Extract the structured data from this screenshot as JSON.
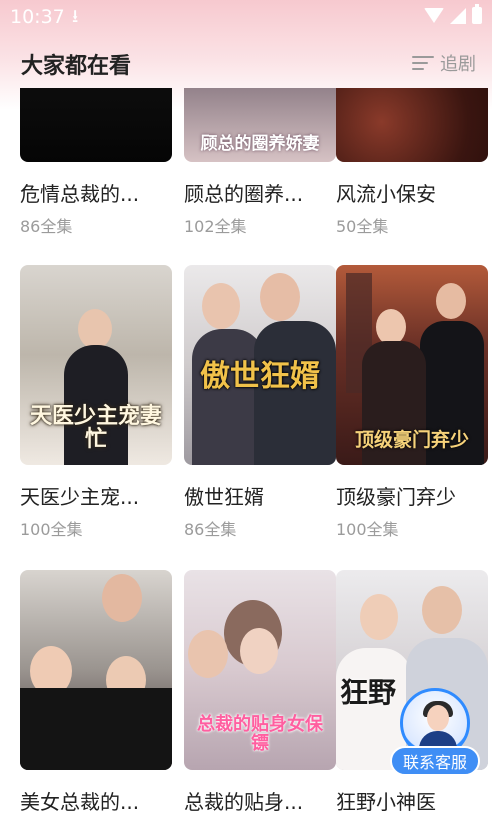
{
  "status_bar": {
    "time": "10:37",
    "download_icon": "download-icon",
    "wifi_icon": "wifi-icon",
    "signal_icon": "signal-icon",
    "battery_icon": "battery-icon"
  },
  "header": {
    "title": "大家都在看",
    "follow_label": "追剧",
    "follow_icon": "list-icon"
  },
  "dramas": [
    {
      "title": "危情总裁的...",
      "episodes": "86全集",
      "poster_text": ""
    },
    {
      "title": "顾总的圈养...",
      "episodes": "102全集",
      "poster_text": "顾总的圈养娇妻"
    },
    {
      "title": "风流小保安",
      "episodes": "50全集",
      "poster_text": ""
    },
    {
      "title": "天医少主宠...",
      "episodes": "100全集",
      "poster_text": "天医少主宠妻忙"
    },
    {
      "title": "傲世狂婿",
      "episodes": "86全集",
      "poster_text": "傲世狂婿"
    },
    {
      "title": "顶级豪门弃少",
      "episodes": "100全集",
      "poster_text": "顶级豪门弃少"
    },
    {
      "title": "美女总裁的...",
      "episodes": "",
      "poster_text": ""
    },
    {
      "title": "总裁的贴身...",
      "episodes": "",
      "poster_text": "总裁的贴身女保镖"
    },
    {
      "title": "狂野小神医",
      "episodes": "",
      "poster_text": "狂野"
    }
  ],
  "customer_service": {
    "label": "联系客服",
    "icon": "agent-avatar-icon"
  },
  "colors": {
    "header_gradient_top": "#f7c9cf",
    "accent_blue": "#3f8ef5",
    "title_text": "#222222",
    "meta_text": "#9b9b9b"
  }
}
